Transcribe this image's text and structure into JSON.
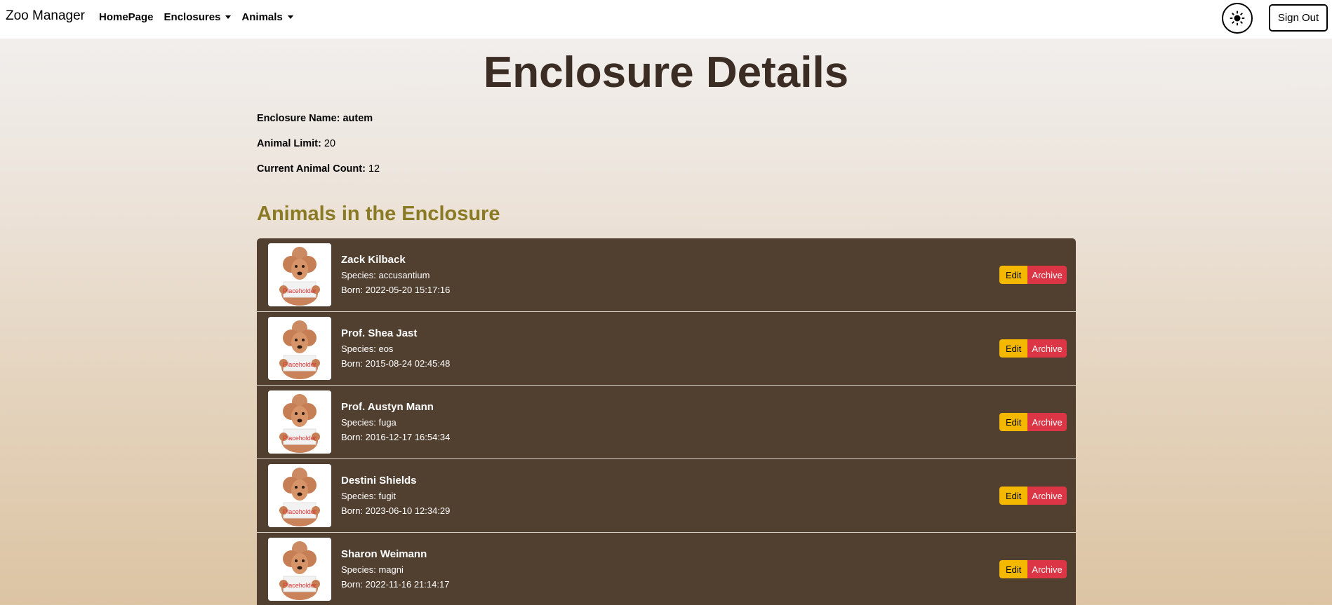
{
  "nav": {
    "brand": "Zoo Manager",
    "links": [
      {
        "label": "HomePage",
        "dropdown": false
      },
      {
        "label": "Enclosures",
        "dropdown": true
      },
      {
        "label": "Animals",
        "dropdown": true
      }
    ],
    "theme_icon": "sun-icon",
    "signout_label": "Sign Out"
  },
  "page": {
    "title": "Enclosure Details",
    "enclosure_name_label": "Enclosure Name: autem",
    "animal_limit_label": "Animal Limit:",
    "animal_limit_value": "20",
    "animal_count_label": "Current Animal Count:",
    "animal_count_value": "12",
    "section_title": "Animals in the Enclosure"
  },
  "animals": [
    {
      "name": "Zack Kilback",
      "species": "Species: accusantium",
      "born": "Born: 2022-05-20 15:17:16",
      "image_label": "Placeholder"
    },
    {
      "name": "Prof. Shea Jast",
      "species": "Species: eos",
      "born": "Born: 2015-08-24 02:45:48",
      "image_label": "Placeholder"
    },
    {
      "name": "Prof. Austyn Mann",
      "species": "Species: fuga",
      "born": "Born: 2016-12-17 16:54:34",
      "image_label": "Placeholder"
    },
    {
      "name": "Destini Shields",
      "species": "Species: fugit",
      "born": "Born: 2023-06-10 12:34:29",
      "image_label": "Placeholder"
    },
    {
      "name": "Sharon Weimann",
      "species": "Species: magni",
      "born": "Born: 2022-11-16 21:14:17",
      "image_label": "Placeholder"
    }
  ],
  "actions": {
    "edit_label": "Edit",
    "archive_label": "Archive"
  },
  "colors": {
    "title": "#3b2c24",
    "section_title": "#8a7a23",
    "card_bg": "#513f30",
    "edit_btn": "#f5b800",
    "archive_btn": "#dc3545"
  }
}
